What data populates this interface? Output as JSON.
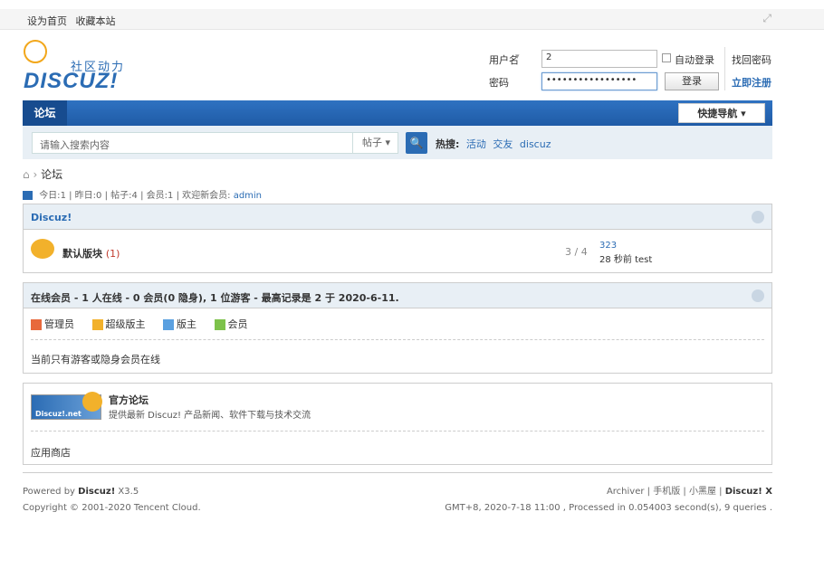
{
  "topbar": {
    "set_home": "设为首页",
    "bookmark": "收藏本站",
    "expand_icon": "expand-icon"
  },
  "logo": {
    "sub": "社区动力",
    "brand": "DISCUZ!"
  },
  "login": {
    "username_label": "用户名",
    "username_value": "2",
    "password_label": "密码",
    "password_value": "•••••••••••••••••",
    "auto_login": "自动登录",
    "login_button": "登录",
    "find_password": "找回密码",
    "register": "立即注册"
  },
  "nav": {
    "forum_tab": "论坛",
    "quick_nav": "快捷导航 ▾"
  },
  "search": {
    "placeholder": "请输入搜索内容",
    "type": "帖子",
    "hot_label": "热搜:",
    "hot_items": [
      "活动",
      "交友",
      "discuz"
    ]
  },
  "breadcrumb": {
    "current": "论坛"
  },
  "stats": {
    "today_label": "今日:",
    "today": "1",
    "yesterday_label": "昨日:",
    "yesterday": "0",
    "posts_label": "帖子:",
    "posts": "4",
    "members_label": "会员:",
    "members": "1",
    "welcome": "欢迎新会员:",
    "new_member": "admin"
  },
  "category": {
    "title": "Discuz!",
    "forum_name": "默认版块",
    "forum_count": "(1)",
    "threads_posts": "3 / 4",
    "last_post_id": "323",
    "last_post_info": "28 秒前 test"
  },
  "online": {
    "header": "在线会员 - 1 人在线 - 0 会员(0 隐身), 1 位游客 - 最高记录是 2 于 2020-6-11.",
    "legend": [
      "管理员",
      "超级版主",
      "版主",
      "会员"
    ],
    "legend_colors": [
      "#e8693c",
      "#f2b12b",
      "#5aa0e0",
      "#7dc24b"
    ],
    "status_text": "当前只有游客或隐身会员在线"
  },
  "links": {
    "img_text": "Discuz!.net",
    "title": "官方论坛",
    "desc": "提供最新 Discuz! 产品新闻、软件下载与技术交流",
    "app_store": "应用商店"
  },
  "footer": {
    "powered_prefix": "Powered by ",
    "powered_brand": "Discuz!",
    "powered_version": " X3.5",
    "copyright": "Copyright © 2001-2020 Tencent Cloud.",
    "archiver": "Archiver",
    "mobile": "手机版",
    "blackroom": "小黑屋",
    "discuz_x": "Discuz! X",
    "time_info": "GMT+8, 2020-7-18 11:00 , Processed in 0.054003 second(s), 9 queries ."
  }
}
